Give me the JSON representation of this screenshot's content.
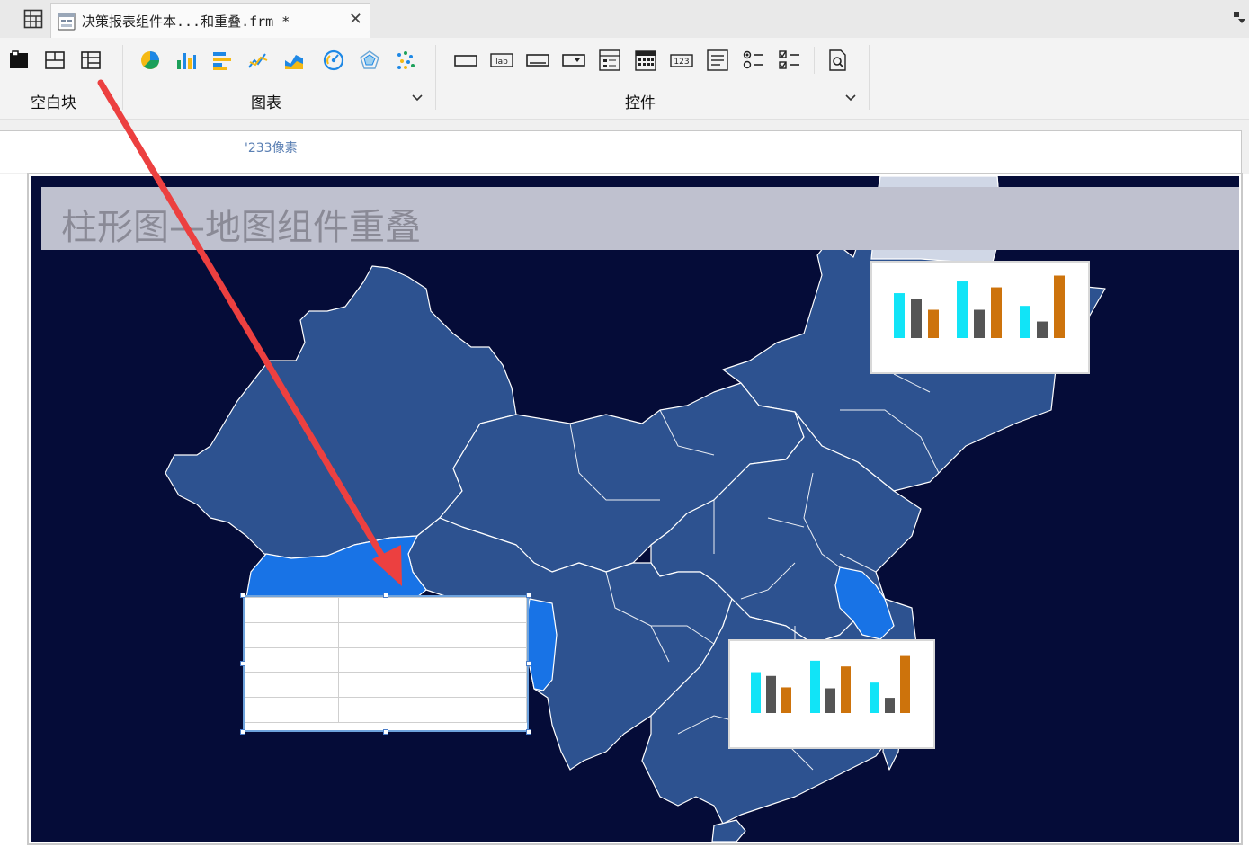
{
  "tabbar": {
    "doc_title": "决策报表组件本...和重叠.frm *",
    "close_glyph": "✕"
  },
  "ribbon": {
    "groups": [
      {
        "label": "空白块",
        "icons": [
          "absolute-block-icon",
          "split-layout-icon",
          "grid-layout-icon"
        ]
      },
      {
        "label": "图表",
        "icons": [
          "pie-chart-icon",
          "bar-chart-icon",
          "horizontal-bar-icon",
          "line-chart-icon",
          "area-chart-icon",
          "gauge-chart-icon",
          "radar-chart-icon",
          "scatter-chart-icon"
        ]
      },
      {
        "label": "控件",
        "icons": [
          "text-field-icon",
          "label-widget-icon",
          "button-widget-icon",
          "dropdown-widget-icon",
          "tree-widget-icon",
          "date-widget-icon",
          "number-widget-icon",
          "multi-line-text-icon",
          "radio-group-icon",
          "checkbox-group-icon",
          "query-button-icon"
        ]
      }
    ],
    "label_widget_text": "lab",
    "number_widget_text": "123"
  },
  "ruler": {
    "text": "'233像素"
  },
  "canvas": {
    "title": "柱形图—地图组件重叠",
    "colors": {
      "background": "#050c38",
      "province": "#2d5290",
      "highlight": "#1873e6",
      "border": "#ffffff"
    }
  },
  "chart_widgets": [
    {
      "name": "chart-widget-northeast",
      "chart_data": {
        "type": "bar",
        "categories": [
          "",
          "",
          ""
        ],
        "series": [
          {
            "color": "#11e4f7",
            "values": [
              46,
              58,
              33
            ]
          },
          {
            "color": "#555555",
            "values": [
              40,
              29,
              17
            ]
          },
          {
            "color": "#cd730c",
            "values": [
              29,
              52,
              64
            ]
          }
        ]
      }
    },
    {
      "name": "chart-widget-south",
      "chart_data": {
        "type": "bar",
        "categories": [
          "",
          "",
          ""
        ],
        "series": [
          {
            "color": "#11e4f7",
            "values": [
              43,
              55,
              32
            ]
          },
          {
            "color": "#555555",
            "values": [
              39,
              26,
              16
            ]
          },
          {
            "color": "#cd730c",
            "values": [
              27,
              49,
              60
            ]
          }
        ]
      }
    }
  ],
  "table_widget": {
    "rows": 5,
    "cols": 3
  }
}
